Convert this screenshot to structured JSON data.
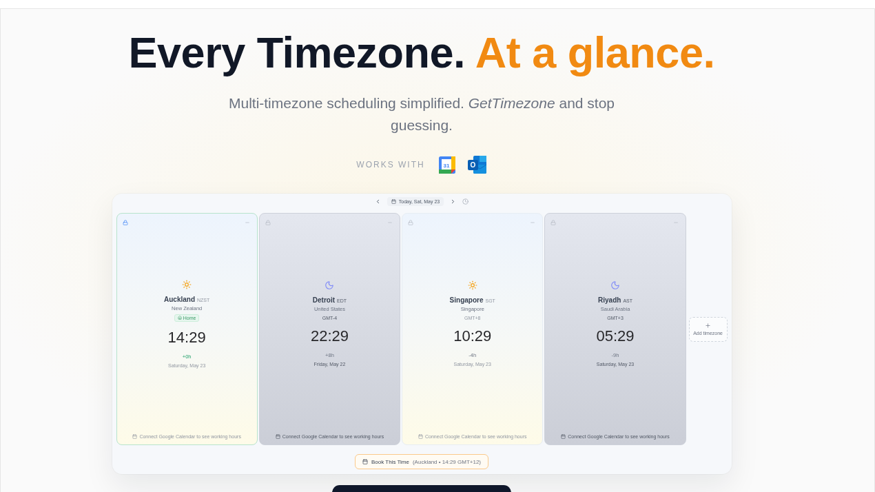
{
  "hero": {
    "headline": "Every Timezone.",
    "headline_accent": "At a glance.",
    "subtitle": "Multi-timezone scheduling simplified. *GetTimezone* and stop guessing."
  },
  "works_with": {
    "label": "WORKS WITH",
    "logos": [
      {
        "kind": "calendar",
        "text": "31"
      },
      {
        "kind": "mail",
        "text": "O"
      }
    ]
  },
  "date_nav": {
    "label": "Today, Sat, May 23"
  },
  "cards": [
    {
      "city": "Auckland",
      "abbr": "NZST",
      "country": "New Zealand",
      "home": true,
      "home_label": "Home",
      "time": "14:29",
      "offset": "+0h",
      "date": "Saturday, May 23",
      "night": false,
      "locked": true,
      "footer": "Connect Google Calendar to see working hours"
    },
    {
      "city": "Detroit",
      "abbr": "EDT",
      "country": "United States",
      "home": false,
      "gmt": "GMT-4",
      "time": "22:29",
      "offset": "+8h",
      "date": "Friday, May 22",
      "night": true,
      "locked": false,
      "footer": "Connect Google Calendar to see working hours"
    },
    {
      "city": "Singapore",
      "abbr": "SGT",
      "country": "Singapore",
      "home": false,
      "gmt": "GMT+8",
      "time": "10:29",
      "offset": "-4h",
      "date": "Saturday, May 23",
      "night": false,
      "locked": false,
      "footer": "Connect Google Calendar to see working hours"
    },
    {
      "city": "Riyadh",
      "abbr": "AST",
      "country": "Saudi Arabia",
      "home": false,
      "gmt": "GMT+3",
      "time": "05:29",
      "offset": "-9h",
      "date": "Saturday, May 23",
      "night": true,
      "locked": false,
      "footer": "Connect Google Calendar to see working hours"
    }
  ],
  "add_timezone": {
    "label": "Add timezone"
  },
  "book": {
    "label": "Book This Time",
    "detail": "(Auckland • 14:29 GMT+12)"
  }
}
